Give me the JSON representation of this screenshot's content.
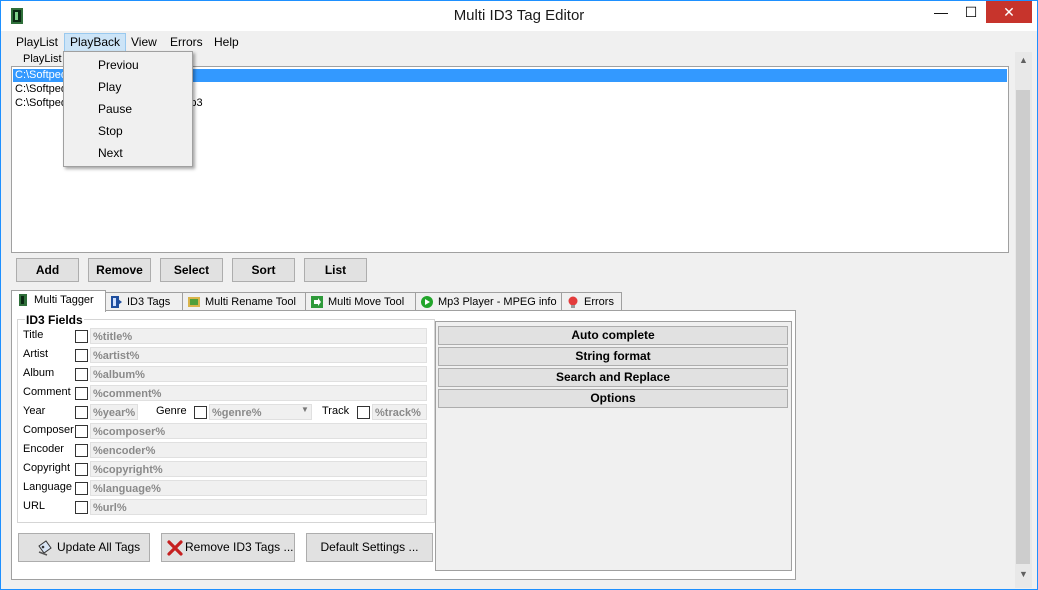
{
  "window": {
    "title": "Multi ID3 Tag Editor"
  },
  "menu": {
    "items": [
      "PlayList",
      "PlayBack",
      "View",
      "Errors",
      "Help"
    ],
    "active": "PlayBack"
  },
  "playback_menu": {
    "items": [
      "Previou",
      "Play",
      "Pause",
      "Stop",
      "Next"
    ]
  },
  "playlist": {
    "label": "PlayList",
    "rows": [
      "C:\\Softpedia",
      "C:\\Softpedia",
      "C:\\Softpedia",
      "a.mp3"
    ],
    "buttons": [
      "Add",
      "Remove",
      "Select",
      "Sort",
      "List"
    ]
  },
  "tabs": [
    "Multi Tagger",
    "ID3 Tags",
    "Multi Rename Tool",
    "Multi Move Tool",
    "Mp3 Player - MPEG info",
    "Errors"
  ],
  "id3_fields": {
    "title": "ID3 Fields",
    "fields": [
      {
        "label": "Title",
        "value": "%title%"
      },
      {
        "label": "Artist",
        "value": "%artist%"
      },
      {
        "label": "Album",
        "value": "%album%"
      },
      {
        "label": "Comment",
        "value": "%comment%"
      },
      {
        "label": "Year",
        "value": "%year%"
      },
      {
        "label": "Composer",
        "value": "%composer%"
      },
      {
        "label": "Encoder",
        "value": "%encoder%"
      },
      {
        "label": "Copyright",
        "value": "%copyright%"
      },
      {
        "label": "Language",
        "value": "%language%"
      },
      {
        "label": "URL",
        "value": "%url%"
      }
    ],
    "genre": {
      "label": "Genre",
      "value": "%genre%"
    },
    "track": {
      "label": "Track",
      "value": "%track%"
    }
  },
  "right_buttons": [
    "Auto complete",
    "String format",
    "Search and Replace",
    "Options"
  ],
  "bottom_buttons": [
    "Update All Tags",
    "Remove ID3 Tags ...",
    "Default Settings ..."
  ],
  "colors": {
    "selection": "#3399ff",
    "close": "#c7342c",
    "accent": "#1e90ff"
  }
}
